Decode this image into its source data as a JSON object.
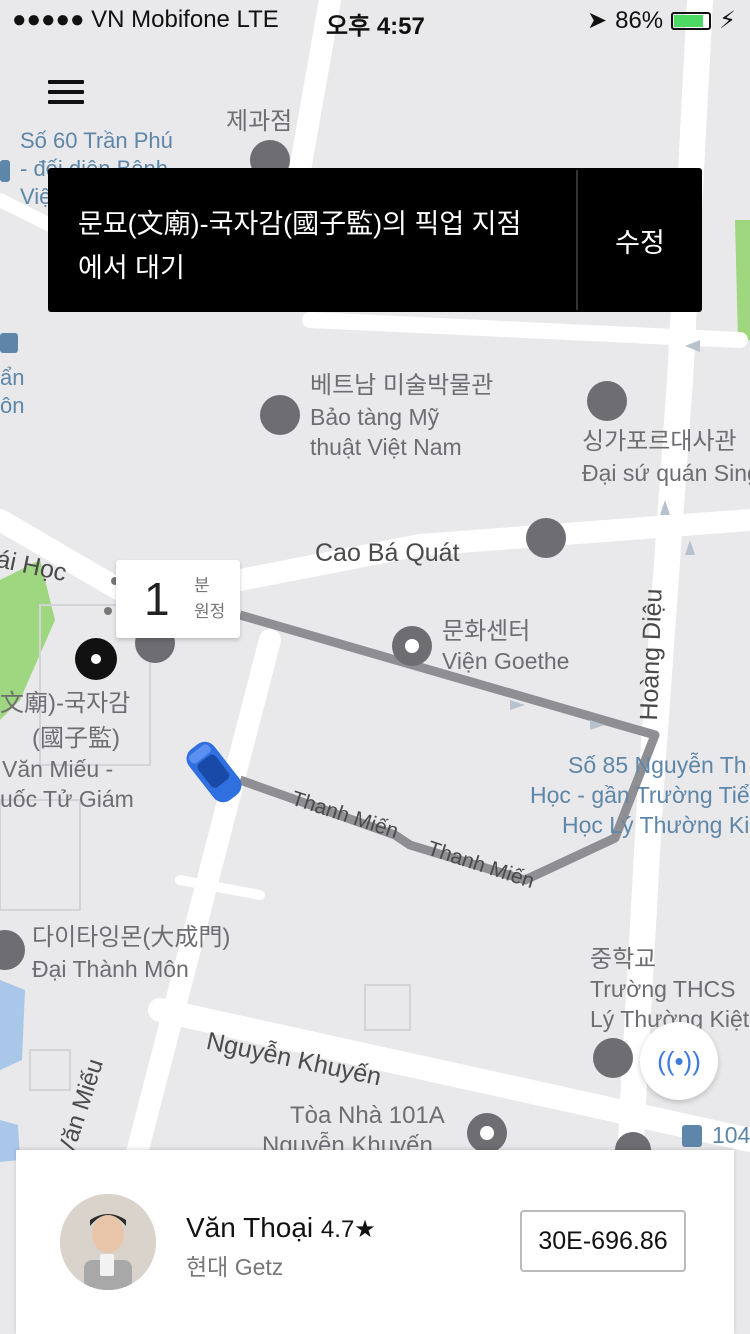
{
  "status_bar": {
    "carrier": "●●●●● VN Mobifone   LTE",
    "time": "오후 4:57",
    "battery": "86%",
    "battery_level": 0.86
  },
  "banner": {
    "message": "문묘(文廟)-국자감(國子監)의 픽업 지점에서 대기",
    "edit_label": "수정"
  },
  "eta": {
    "value": "1",
    "unit_line1": "분",
    "unit_line2": "원정"
  },
  "map_labels": {
    "street_tran_phu": "Số 60 Trần Phú",
    "street_tran_phu2": "- đối diện Bệnh",
    "street_tran_phu3": "Việ",
    "che_kwa": "제과점",
    "museum_ko": "베트남 미술박물관",
    "museum_vi1": "Bảo tàng Mỹ",
    "museum_vi2": "thuật Việt Nam",
    "embassy_ko": "싱가포르대사관",
    "embassy_vi": "Đại sứ quán Sing",
    "cao_ba_quat": "Cao Bá Quát",
    "goethe_ko": "문화센터",
    "goethe_vi": "Viện Goethe",
    "hoang_dieu": "Hoàng Diệu",
    "temple_ko1": "文廟)-국자감",
    "temple_ko2": "(國子監)",
    "temple_vi1": "Văn Miếu -",
    "temple_vi2": "uốc Tử Giám",
    "so85_1": "Số 85 Nguyễn Th",
    "so85_2": "Học - gần Trường Tiể",
    "so85_3": "Học Lý Thường Ki",
    "thanh_mien": "Thanh Miến",
    "thanh_mien2": "Thanh Miến",
    "dai_thanh_ko": "다이타잉몬(大成門)",
    "dai_thanh_vi": "Đại Thành Môn",
    "school_ko": "중학교",
    "school_vi1": "Trường THCS",
    "school_vi2": "Lý Thường Kiệt",
    "nguyen_khuyen": "Nguyễn Khuyến",
    "van_mieu": "Văn Miếu",
    "toa_nha1": "Tòa Nhà 101A",
    "toa_nha2": "Nguyễn Khuyến",
    "bus_104": "104",
    "hoc": "ái Học",
    "an": "ẩn",
    "on": "ôn"
  },
  "driver": {
    "name": "Văn Thoại",
    "rating": "4.7★",
    "car": "현대 Getz",
    "plate": "30E-696.86"
  },
  "colors": {
    "map_bg": "#e9e9eb",
    "road": "#ffffff",
    "route": "#8e8e93",
    "car": "#2f6fe0",
    "park": "#8fd16b",
    "water": "#a9c7e8"
  }
}
